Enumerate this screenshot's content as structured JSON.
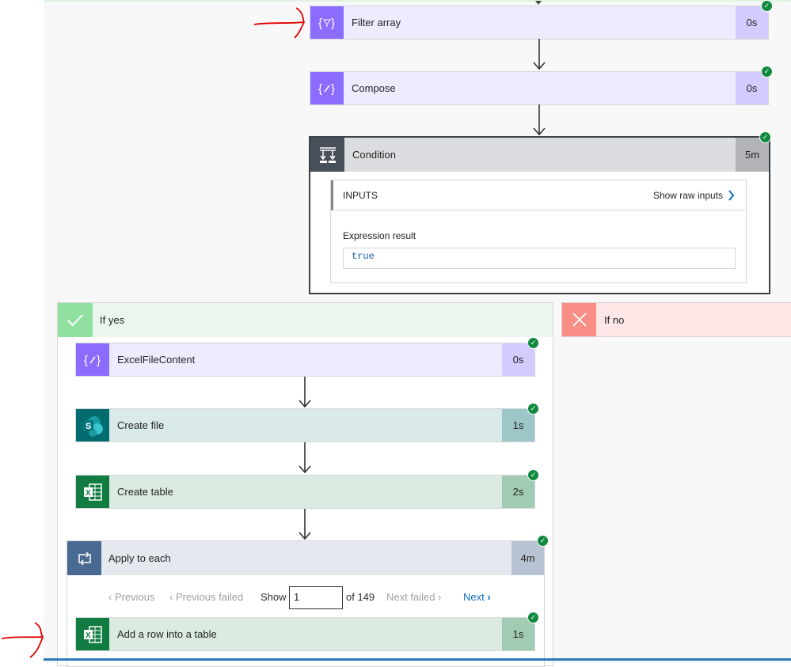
{
  "steps": {
    "filter_array": {
      "title": "Filter array",
      "duration": "0s",
      "icon": "filter-braces-icon"
    },
    "compose": {
      "title": "Compose",
      "duration": "0s",
      "icon": "compose-braces-icon"
    },
    "condition": {
      "title": "Condition",
      "duration": "5m",
      "icon": "condition-icon",
      "inputs_label": "INPUTS",
      "show_raw_inputs": "Show raw inputs",
      "expression_label": "Expression result",
      "expression_value": "true"
    }
  },
  "branches": {
    "yes": {
      "label": "If yes",
      "color": "#8fe0a1"
    },
    "no": {
      "label": "If no",
      "color": "#f88e85"
    }
  },
  "yes_steps": {
    "excel_file_content": {
      "title": "ExcelFileContent",
      "duration": "0s"
    },
    "create_file": {
      "title": "Create file",
      "duration": "1s",
      "icon": "sharepoint-icon"
    },
    "create_table": {
      "title": "Create table",
      "duration": "2s",
      "icon": "excel-icon"
    },
    "apply_to_each": {
      "title": "Apply to each",
      "duration": "4m",
      "icon": "loop-icon",
      "pager": {
        "previous": "Previous",
        "previous_failed": "Previous failed",
        "show": "Show",
        "current": "1",
        "of_total": "of 149",
        "next_failed": "Next failed",
        "next": "Next"
      },
      "add_row": {
        "title": "Add a row into a table",
        "duration": "1s",
        "icon": "excel-icon"
      }
    }
  },
  "colors": {
    "accent_link": "#0f6cbd",
    "success": "#0f8a3e",
    "annotation": "#e00000"
  }
}
